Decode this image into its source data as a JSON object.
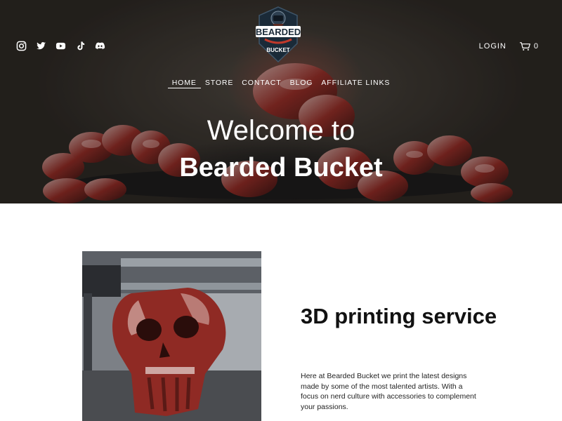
{
  "header": {
    "logo": {
      "top_text": "BEARDED",
      "bottom_text": "BUCKET"
    },
    "social_icons": [
      "instagram-icon",
      "twitter-icon",
      "youtube-icon",
      "tiktok-icon",
      "discord-icon"
    ],
    "login_label": "LOGIN",
    "cart_count": "0"
  },
  "nav": {
    "items": [
      {
        "label": "HOME",
        "active": true
      },
      {
        "label": "STORE",
        "active": false
      },
      {
        "label": "CONTACT",
        "active": false
      },
      {
        "label": "BLOG",
        "active": false
      },
      {
        "label": "AFFILIATE LINKS",
        "active": false
      }
    ]
  },
  "hero": {
    "title_line1": "Welcome to",
    "title_line2": "Bearded Bucket"
  },
  "intro": {
    "heading": "3D printing service",
    "body": "Here at Bearded Bucket we print the latest designs made by some of the most talented artists. With a focus on nerd culture with accessories to complement your passions."
  },
  "colors": {
    "accent_red": "#a3322a",
    "text_dark": "#111111",
    "hero_overlay": "#2a2622"
  }
}
